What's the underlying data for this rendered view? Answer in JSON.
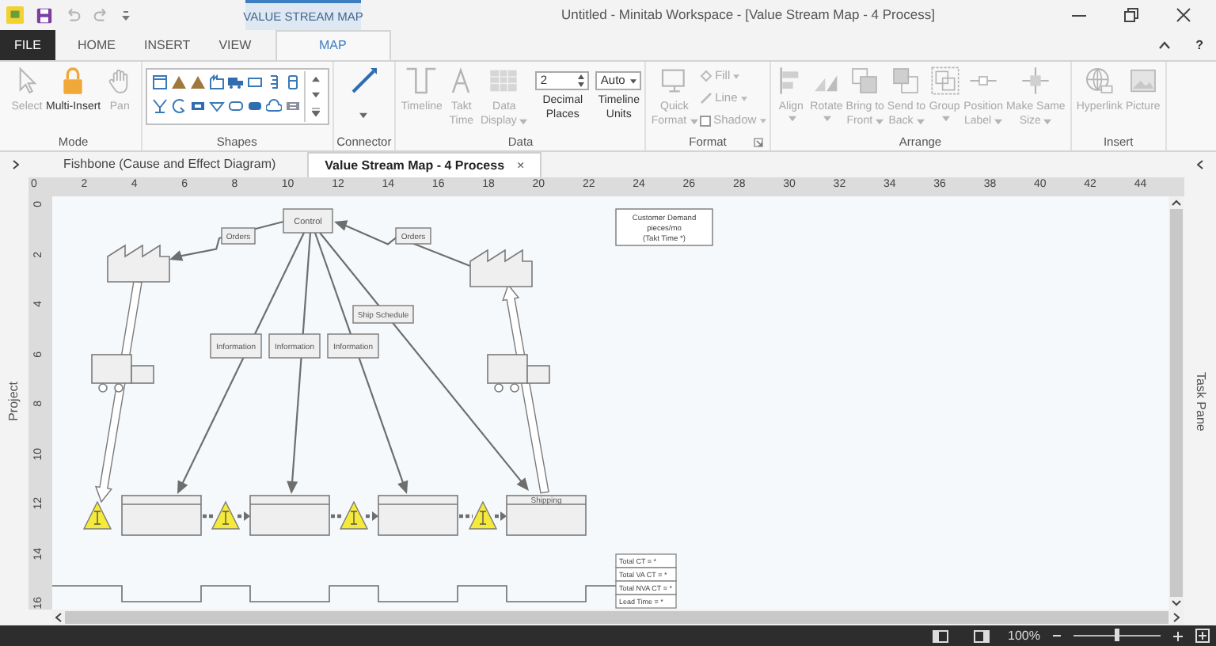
{
  "title_bar": {
    "contextual_tab": "VALUE STREAM MAP",
    "title": "Untitled - Minitab Workspace - [Value Stream Map - 4 Process]"
  },
  "ribbon_tabs": [
    {
      "label": "FILE",
      "kind": "file",
      "selected": false
    },
    {
      "label": "HOME",
      "kind": "tab",
      "selected": false
    },
    {
      "label": "INSERT",
      "kind": "tab",
      "selected": false
    },
    {
      "label": "VIEW",
      "kind": "tab",
      "selected": false
    },
    {
      "label": "MAP",
      "kind": "contextual",
      "selected": true
    }
  ],
  "help": "?",
  "ribbon_groups": [
    {
      "label": "Mode",
      "items": [
        {
          "kind": "large",
          "label_lines": [
            "Select"
          ],
          "disabled": true
        },
        {
          "kind": "large",
          "label_lines": [
            "Multi-Insert"
          ],
          "disabled": false
        },
        {
          "kind": "large",
          "label_lines": [
            "Pan"
          ],
          "disabled": true
        }
      ]
    },
    {
      "label": "Shapes",
      "items": [
        {
          "kind": "gallery"
        }
      ]
    },
    {
      "label": "Connector",
      "items": [
        {
          "kind": "connector"
        }
      ]
    },
    {
      "label": "Data",
      "items": [
        {
          "kind": "large",
          "label_lines": [
            "Timeline"
          ],
          "disabled": true
        },
        {
          "kind": "large",
          "label_lines": [
            "Takt",
            "Time"
          ],
          "disabled": true
        },
        {
          "kind": "large",
          "label_lines": [
            "Data",
            "Display"
          ],
          "dropdown": true,
          "disabled": true
        },
        {
          "kind": "spin",
          "value": "2",
          "label_lines": [
            "Decimal",
            "Places"
          ]
        },
        {
          "kind": "select",
          "value": "Auto",
          "label_lines": [
            "Timeline",
            "Units"
          ]
        }
      ]
    },
    {
      "label": "Format",
      "launcher": true,
      "items": [
        {
          "kind": "large",
          "label_lines": [
            "Quick",
            "Format"
          ],
          "dropdown": true,
          "disabled": true
        },
        {
          "kind": "stack",
          "rows": [
            {
              "label": "Fill",
              "dropdown": true,
              "disabled": true
            },
            {
              "label": "Line",
              "dropdown": true,
              "disabled": true
            },
            {
              "label": "Shadow",
              "dropdown": true,
              "disabled": true,
              "checked": false
            }
          ]
        }
      ]
    },
    {
      "label": "Arrange",
      "items": [
        {
          "kind": "large",
          "label_lines": [
            "Align"
          ],
          "dropdown": true,
          "disabled": true
        },
        {
          "kind": "large",
          "label_lines": [
            "Rotate"
          ],
          "dropdown": true,
          "disabled": true
        },
        {
          "kind": "large",
          "label_lines": [
            "Bring to",
            "Front"
          ],
          "dropdown": true,
          "disabled": true
        },
        {
          "kind": "large",
          "label_lines": [
            "Send to",
            "Back"
          ],
          "dropdown": true,
          "disabled": true
        },
        {
          "kind": "large",
          "label_lines": [
            "Group"
          ],
          "dropdown": true,
          "disabled": true
        },
        {
          "kind": "large",
          "label_lines": [
            "Position",
            "Label"
          ],
          "dropdown": true,
          "disabled": true
        },
        {
          "kind": "large",
          "label_lines": [
            "Make Same",
            "Size"
          ],
          "dropdown": true,
          "disabled": true
        }
      ]
    },
    {
      "label": "Insert",
      "items": [
        {
          "kind": "large",
          "label_lines": [
            "Hyperlink"
          ],
          "disabled": true
        },
        {
          "kind": "large",
          "label_lines": [
            "Picture"
          ],
          "disabled": true
        }
      ]
    }
  ],
  "doc_tabs": [
    {
      "label": "Fishbone (Cause and Effect Diagram)",
      "selected": false
    },
    {
      "label": "Value Stream Map - 4 Process",
      "selected": true,
      "close": "×"
    }
  ],
  "left_panel": {
    "label": "Project"
  },
  "right_panel": {
    "label": "Task Pane"
  },
  "ruler": {
    "x_labels": [
      "0",
      "2",
      "4",
      "6",
      "8",
      "10",
      "12",
      "14",
      "16",
      "18",
      "20",
      "22",
      "24",
      "26",
      "28",
      "30",
      "32",
      "34",
      "36",
      "38",
      "40",
      "42",
      "44"
    ],
    "y_labels": [
      "0",
      "2",
      "4",
      "6",
      "8",
      "10",
      "12",
      "14",
      "16"
    ]
  },
  "diagram": {
    "control_label": "Control",
    "order_labels": [
      "Orders",
      "Orders"
    ],
    "info_labels": [
      "Information",
      "Information",
      "Information"
    ],
    "schedule_label": "Ship Schedule",
    "shipping_label": "Shipping",
    "customer_demand_lines": [
      "Customer Demand",
      "pieces/mo",
      "(Takt Time *)"
    ],
    "summary_lines": [
      "Total CT = *",
      "Total VA CT = *",
      "Total NVA CT = *",
      "Lead Time = *"
    ]
  },
  "status_bar": {
    "zoom_text": "100%",
    "zoom_slider": {
      "level": 0.5
    }
  }
}
